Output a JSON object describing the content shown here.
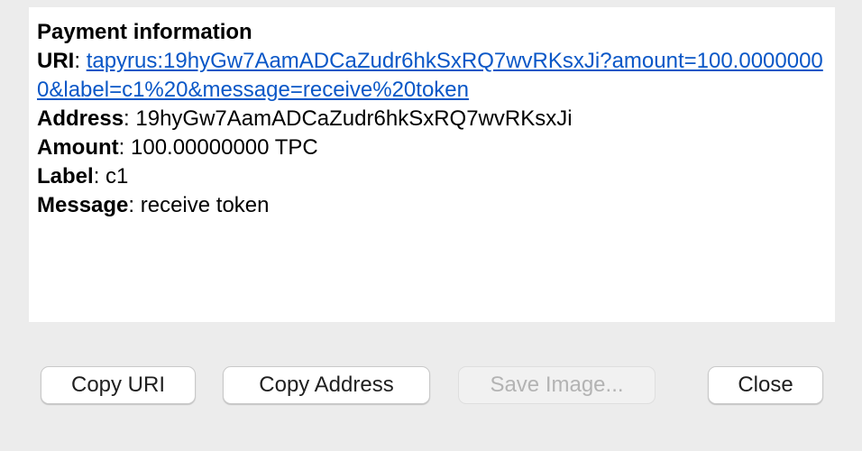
{
  "payment": {
    "heading": "Payment information",
    "uri_label": "URI",
    "uri_value": "tapyrus:19hyGw7AamADCaZudr6hkSxRQ7wvRKsxJi?amount=100.00000000&label=c1%20&message=receive%20token",
    "address_label": "Address",
    "address_value": "19hyGw7AamADCaZudr6hkSxRQ7wvRKsxJi",
    "amount_label": "Amount",
    "amount_value": "100.00000000 TPC",
    "label_label": "Label",
    "label_value": "c1",
    "message_label": "Message",
    "message_value": "receive token",
    "separator": ": "
  },
  "buttons": {
    "copy_uri": "Copy URI",
    "copy_address": "Copy Address",
    "save_image": "Save Image...",
    "close": "Close"
  },
  "colors": {
    "link": "#0a57c7",
    "window_background": "#ececec",
    "panel_background": "#ffffff"
  }
}
